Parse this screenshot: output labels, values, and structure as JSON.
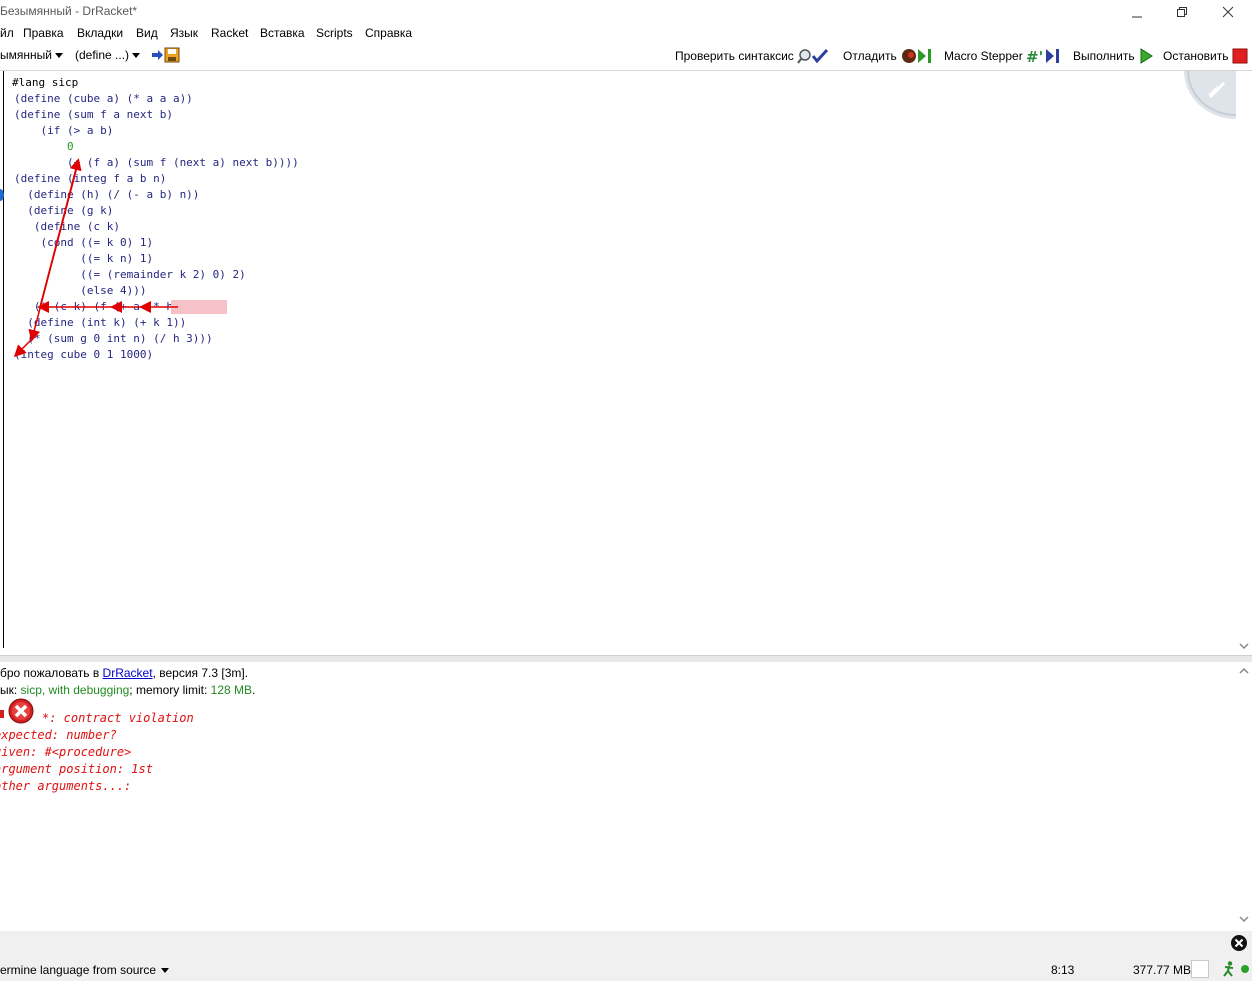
{
  "window": {
    "title": "Безымянный - DrRacket*"
  },
  "menu": [
    "йл",
    "Правка",
    "Вкладки",
    "Вид",
    "Язык",
    "Racket",
    "Вставка",
    "Scripts",
    "Справка"
  ],
  "toolbar": {
    "file_dropdown": "ымянный",
    "define_dropdown": "(define ...)",
    "check_syntax": "Проверить синтаксис",
    "debug": "Отладить",
    "macro_stepper": "Macro Stepper",
    "run": "Выполнить",
    "stop": "Остановить"
  },
  "editor": {
    "lines": [
      "#lang sicp",
      "(define (cube a) (* a a a))",
      "(define (sum f a next b)",
      "    (if (> a b)",
      "        0",
      "        (+ (f a) (sum f (next a) next b))))",
      "(define (integ f a b n)",
      "  (define (h) (/ (- a b) n))",
      "  (define (g k)",
      "   (define (c k)",
      "    (cond ((= k 0) 1)",
      "          ((= k n) 1)",
      "          ((= (remainder k 2) 0) 2)",
      "          (else 4)))",
      "   (* (c k) (f (+ a (* h k)))))",
      "  (define (int k) (+ k 1))",
      "  (* (sum g 0 int n) (/ h 3)))",
      "(integ cube 0 1 1000)"
    ],
    "highlighted": "(* h k)"
  },
  "interactions": {
    "welcome_prefix": "бро пожаловать в ",
    "welcome_link": "DrRacket",
    "welcome_suffix": ", версия 7.3 [3m].",
    "lang_prefix": "ык: ",
    "lang_name": "sicp, with debugging",
    "lang_mid": "; memory limit: ",
    "lang_mem": "128 MB",
    "lang_end": ".",
    "error_lines": [
      "*: contract violation",
      "expected: number?",
      "given: #<procedure>",
      "argument position: 1st",
      "other arguments...:"
    ]
  },
  "status": {
    "language": "ermine language from source",
    "position": "8:13",
    "memory": "377.77 MB"
  },
  "colors": {
    "error": "#e01010",
    "arrow": "#e00000",
    "highlight": "#f6c1c8",
    "link": "#0000cc",
    "lang_green": "#228b22"
  }
}
